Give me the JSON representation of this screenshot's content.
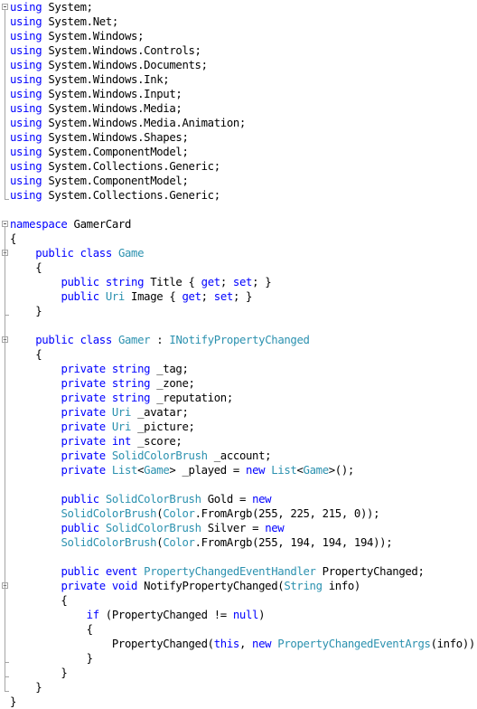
{
  "editor": {
    "language": "C#",
    "colors": {
      "keyword": "#0000ff",
      "type": "#2b91af",
      "plain": "#000000",
      "outline": "#a5a5a5"
    },
    "lines": [
      [
        {
          "t": "using",
          "c": "kw"
        },
        {
          "t": " System;",
          "c": "pl"
        }
      ],
      [
        {
          "t": "using",
          "c": "kw"
        },
        {
          "t": " System.Net;",
          "c": "pl"
        }
      ],
      [
        {
          "t": "using",
          "c": "kw"
        },
        {
          "t": " System.Windows;",
          "c": "pl"
        }
      ],
      [
        {
          "t": "using",
          "c": "kw"
        },
        {
          "t": " System.Windows.Controls;",
          "c": "pl"
        }
      ],
      [
        {
          "t": "using",
          "c": "kw"
        },
        {
          "t": " System.Windows.Documents;",
          "c": "pl"
        }
      ],
      [
        {
          "t": "using",
          "c": "kw"
        },
        {
          "t": " System.Windows.Ink;",
          "c": "pl"
        }
      ],
      [
        {
          "t": "using",
          "c": "kw"
        },
        {
          "t": " System.Windows.Input;",
          "c": "pl"
        }
      ],
      [
        {
          "t": "using",
          "c": "kw"
        },
        {
          "t": " System.Windows.Media;",
          "c": "pl"
        }
      ],
      [
        {
          "t": "using",
          "c": "kw"
        },
        {
          "t": " System.Windows.Media.Animation;",
          "c": "pl"
        }
      ],
      [
        {
          "t": "using",
          "c": "kw"
        },
        {
          "t": " System.Windows.Shapes;",
          "c": "pl"
        }
      ],
      [
        {
          "t": "using",
          "c": "kw"
        },
        {
          "t": " System.ComponentModel;",
          "c": "pl"
        }
      ],
      [
        {
          "t": "using",
          "c": "kw"
        },
        {
          "t": " System.Collections.Generic;",
          "c": "pl"
        }
      ],
      [
        {
          "t": "using",
          "c": "kw"
        },
        {
          "t": " System.ComponentModel;",
          "c": "pl"
        }
      ],
      [
        {
          "t": "using",
          "c": "kw"
        },
        {
          "t": " System.Collections.Generic;",
          "c": "pl"
        }
      ],
      [],
      [
        {
          "t": "namespace",
          "c": "kw"
        },
        {
          "t": " GamerCard",
          "c": "pl"
        }
      ],
      [
        {
          "t": "{",
          "c": "pl"
        }
      ],
      [
        {
          "t": "    ",
          "c": "pl"
        },
        {
          "t": "public",
          "c": "kw"
        },
        {
          "t": " ",
          "c": "pl"
        },
        {
          "t": "class",
          "c": "kw"
        },
        {
          "t": " ",
          "c": "pl"
        },
        {
          "t": "Game",
          "c": "ty"
        }
      ],
      [
        {
          "t": "    {",
          "c": "pl"
        }
      ],
      [
        {
          "t": "        ",
          "c": "pl"
        },
        {
          "t": "public",
          "c": "kw"
        },
        {
          "t": " ",
          "c": "pl"
        },
        {
          "t": "string",
          "c": "kw"
        },
        {
          "t": " Title { ",
          "c": "pl"
        },
        {
          "t": "get",
          "c": "kw"
        },
        {
          "t": "; ",
          "c": "pl"
        },
        {
          "t": "set",
          "c": "kw"
        },
        {
          "t": "; }",
          "c": "pl"
        }
      ],
      [
        {
          "t": "        ",
          "c": "pl"
        },
        {
          "t": "public",
          "c": "kw"
        },
        {
          "t": " ",
          "c": "pl"
        },
        {
          "t": "Uri",
          "c": "ty"
        },
        {
          "t": " Image { ",
          "c": "pl"
        },
        {
          "t": "get",
          "c": "kw"
        },
        {
          "t": "; ",
          "c": "pl"
        },
        {
          "t": "set",
          "c": "kw"
        },
        {
          "t": "; }",
          "c": "pl"
        }
      ],
      [
        {
          "t": "    }",
          "c": "pl"
        }
      ],
      [],
      [
        {
          "t": "    ",
          "c": "pl"
        },
        {
          "t": "public",
          "c": "kw"
        },
        {
          "t": " ",
          "c": "pl"
        },
        {
          "t": "class",
          "c": "kw"
        },
        {
          "t": " ",
          "c": "pl"
        },
        {
          "t": "Gamer",
          "c": "ty"
        },
        {
          "t": " : ",
          "c": "pl"
        },
        {
          "t": "INotifyPropertyChanged",
          "c": "ty"
        }
      ],
      [
        {
          "t": "    {",
          "c": "pl"
        }
      ],
      [
        {
          "t": "        ",
          "c": "pl"
        },
        {
          "t": "private",
          "c": "kw"
        },
        {
          "t": " ",
          "c": "pl"
        },
        {
          "t": "string",
          "c": "kw"
        },
        {
          "t": " _tag;",
          "c": "pl"
        }
      ],
      [
        {
          "t": "        ",
          "c": "pl"
        },
        {
          "t": "private",
          "c": "kw"
        },
        {
          "t": " ",
          "c": "pl"
        },
        {
          "t": "string",
          "c": "kw"
        },
        {
          "t": " _zone;",
          "c": "pl"
        }
      ],
      [
        {
          "t": "        ",
          "c": "pl"
        },
        {
          "t": "private",
          "c": "kw"
        },
        {
          "t": " ",
          "c": "pl"
        },
        {
          "t": "string",
          "c": "kw"
        },
        {
          "t": " _reputation;",
          "c": "pl"
        }
      ],
      [
        {
          "t": "        ",
          "c": "pl"
        },
        {
          "t": "private",
          "c": "kw"
        },
        {
          "t": " ",
          "c": "pl"
        },
        {
          "t": "Uri",
          "c": "ty"
        },
        {
          "t": " _avatar;",
          "c": "pl"
        }
      ],
      [
        {
          "t": "        ",
          "c": "pl"
        },
        {
          "t": "private",
          "c": "kw"
        },
        {
          "t": " ",
          "c": "pl"
        },
        {
          "t": "Uri",
          "c": "ty"
        },
        {
          "t": " _picture;",
          "c": "pl"
        }
      ],
      [
        {
          "t": "        ",
          "c": "pl"
        },
        {
          "t": "private",
          "c": "kw"
        },
        {
          "t": " ",
          "c": "pl"
        },
        {
          "t": "int",
          "c": "kw"
        },
        {
          "t": " _score;",
          "c": "pl"
        }
      ],
      [
        {
          "t": "        ",
          "c": "pl"
        },
        {
          "t": "private",
          "c": "kw"
        },
        {
          "t": " ",
          "c": "pl"
        },
        {
          "t": "SolidColorBrush",
          "c": "ty"
        },
        {
          "t": " _account;",
          "c": "pl"
        }
      ],
      [
        {
          "t": "        ",
          "c": "pl"
        },
        {
          "t": "private",
          "c": "kw"
        },
        {
          "t": " ",
          "c": "pl"
        },
        {
          "t": "List",
          "c": "ty"
        },
        {
          "t": "<",
          "c": "pl"
        },
        {
          "t": "Game",
          "c": "ty"
        },
        {
          "t": "> _played = ",
          "c": "pl"
        },
        {
          "t": "new",
          "c": "kw"
        },
        {
          "t": " ",
          "c": "pl"
        },
        {
          "t": "List",
          "c": "ty"
        },
        {
          "t": "<",
          "c": "pl"
        },
        {
          "t": "Game",
          "c": "ty"
        },
        {
          "t": ">();",
          "c": "pl"
        }
      ],
      [],
      [
        {
          "t": "        ",
          "c": "pl"
        },
        {
          "t": "public",
          "c": "kw"
        },
        {
          "t": " ",
          "c": "pl"
        },
        {
          "t": "SolidColorBrush",
          "c": "ty"
        },
        {
          "t": " Gold = ",
          "c": "pl"
        },
        {
          "t": "new",
          "c": "kw"
        }
      ],
      [
        {
          "t": "        ",
          "c": "pl"
        },
        {
          "t": "SolidColorBrush",
          "c": "ty"
        },
        {
          "t": "(",
          "c": "pl"
        },
        {
          "t": "Color",
          "c": "ty"
        },
        {
          "t": ".FromArgb(255, 225, 215, 0));",
          "c": "pl"
        }
      ],
      [
        {
          "t": "        ",
          "c": "pl"
        },
        {
          "t": "public",
          "c": "kw"
        },
        {
          "t": " ",
          "c": "pl"
        },
        {
          "t": "SolidColorBrush",
          "c": "ty"
        },
        {
          "t": " Silver = ",
          "c": "pl"
        },
        {
          "t": "new",
          "c": "kw"
        }
      ],
      [
        {
          "t": "        ",
          "c": "pl"
        },
        {
          "t": "SolidColorBrush",
          "c": "ty"
        },
        {
          "t": "(",
          "c": "pl"
        },
        {
          "t": "Color",
          "c": "ty"
        },
        {
          "t": ".FromArgb(255, 194, 194, 194));",
          "c": "pl"
        }
      ],
      [],
      [
        {
          "t": "        ",
          "c": "pl"
        },
        {
          "t": "public",
          "c": "kw"
        },
        {
          "t": " ",
          "c": "pl"
        },
        {
          "t": "event",
          "c": "kw"
        },
        {
          "t": " ",
          "c": "pl"
        },
        {
          "t": "PropertyChangedEventHandler",
          "c": "ty"
        },
        {
          "t": " PropertyChanged;",
          "c": "pl"
        }
      ],
      [
        {
          "t": "        ",
          "c": "pl"
        },
        {
          "t": "private",
          "c": "kw"
        },
        {
          "t": " ",
          "c": "pl"
        },
        {
          "t": "void",
          "c": "kw"
        },
        {
          "t": " NotifyPropertyChanged(",
          "c": "pl"
        },
        {
          "t": "String",
          "c": "ty"
        },
        {
          "t": " info)",
          "c": "pl"
        }
      ],
      [
        {
          "t": "        {",
          "c": "pl"
        }
      ],
      [
        {
          "t": "            ",
          "c": "pl"
        },
        {
          "t": "if",
          "c": "kw"
        },
        {
          "t": " (PropertyChanged != ",
          "c": "pl"
        },
        {
          "t": "null",
          "c": "kw"
        },
        {
          "t": ")",
          "c": "pl"
        }
      ],
      [
        {
          "t": "            {",
          "c": "pl"
        }
      ],
      [
        {
          "t": "                PropertyChanged(",
          "c": "pl"
        },
        {
          "t": "this",
          "c": "kw"
        },
        {
          "t": ", ",
          "c": "pl"
        },
        {
          "t": "new",
          "c": "kw"
        },
        {
          "t": " ",
          "c": "pl"
        },
        {
          "t": "PropertyChangedEventArgs",
          "c": "ty"
        },
        {
          "t": "(info));",
          "c": "pl"
        }
      ],
      [
        {
          "t": "            }",
          "c": "pl"
        }
      ],
      [
        {
          "t": "        }",
          "c": "pl"
        }
      ],
      [
        {
          "t": "    }",
          "c": "pl"
        }
      ],
      [
        {
          "t": "}",
          "c": "pl"
        }
      ]
    ],
    "outlining": {
      "collapse_markers": [
        {
          "line": 0,
          "region": "using-directives",
          "state": "expanded"
        },
        {
          "line": 15,
          "region": "namespace-GamerCard",
          "state": "expanded"
        },
        {
          "line": 17,
          "region": "class-Game",
          "state": "expanded"
        },
        {
          "line": 23,
          "region": "class-Gamer",
          "state": "expanded"
        },
        {
          "line": 40,
          "region": "method-NotifyPropertyChanged",
          "state": "expanded"
        }
      ]
    }
  }
}
